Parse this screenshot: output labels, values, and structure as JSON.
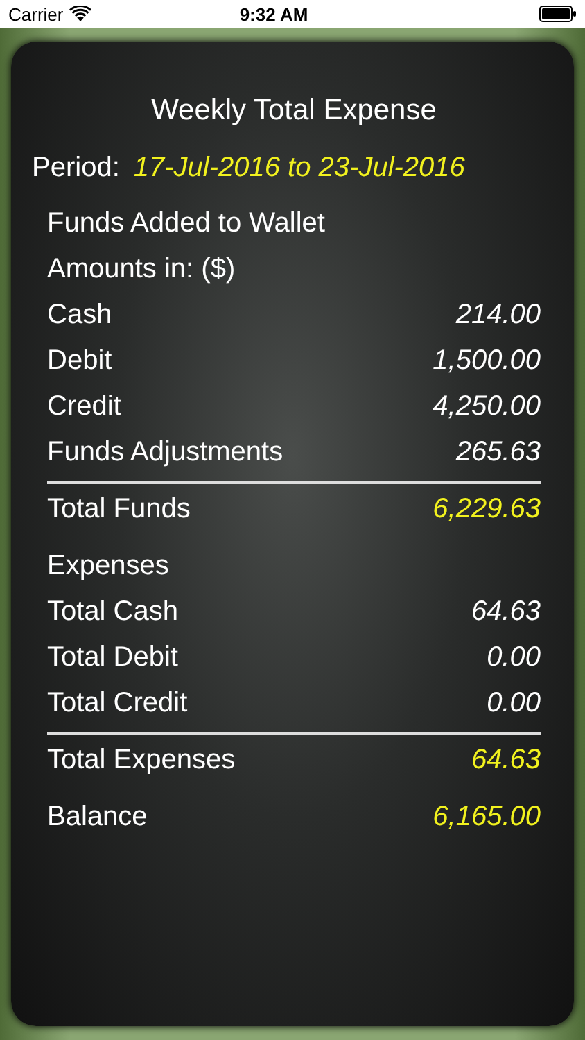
{
  "status_bar": {
    "carrier": "Carrier",
    "time": "9:32 AM"
  },
  "title": "Weekly Total Expense",
  "period": {
    "label": "Period:",
    "value": "17-Jul-2016 to 23-Jul-2016"
  },
  "lines": [
    {
      "kind": "heading",
      "label": "Funds Added to Wallet"
    },
    {
      "kind": "heading",
      "label": "Amounts in: ($)"
    },
    {
      "kind": "item",
      "label": "Cash",
      "value": "214.00"
    },
    {
      "kind": "item",
      "label": "Debit",
      "value": "1,500.00"
    },
    {
      "kind": "item",
      "label": "Credit",
      "value": "4,250.00"
    },
    {
      "kind": "item",
      "label": "Funds Adjustments",
      "value": "265.63"
    },
    {
      "kind": "total",
      "label": "Total Funds",
      "value": "6,229.63"
    },
    {
      "kind": "heading",
      "label": "Expenses"
    },
    {
      "kind": "item",
      "label": "Total Cash",
      "value": "64.63"
    },
    {
      "kind": "item",
      "label": "Total Debit",
      "value": "0.00"
    },
    {
      "kind": "item",
      "label": "Total Credit",
      "value": "0.00"
    },
    {
      "kind": "total",
      "label": "Total Expenses",
      "value": "64.63"
    },
    {
      "kind": "balance",
      "label": "Balance",
      "value": "6,165.00"
    }
  ]
}
